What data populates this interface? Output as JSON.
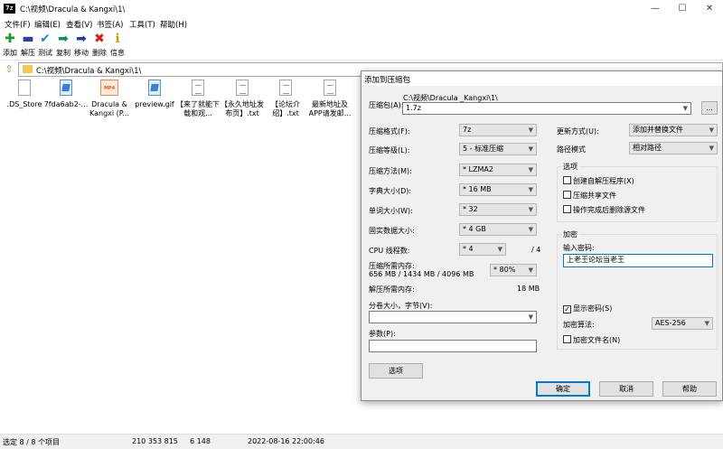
{
  "window": {
    "app_icon": "7z",
    "title": "C:\\视频\\Dracula & Kangxi\\1\\",
    "minimize_glyph": "—",
    "maximize_glyph": "☐",
    "close_glyph": "✕"
  },
  "menu": [
    "文件(F)",
    "编辑(E)",
    "查看(V)",
    "书签(A)",
    "工具(T)",
    "帮助(H)"
  ],
  "toolbar": [
    {
      "label": "添加",
      "icon": "add-icon",
      "glyph": "✚",
      "color": "#1a9b2c"
    },
    {
      "label": "解压",
      "icon": "extract-icon",
      "glyph": "▬",
      "color": "#2b3fa5"
    },
    {
      "label": "测试",
      "icon": "test-icon",
      "glyph": "✔",
      "color": "#1f8ea8"
    },
    {
      "label": "复制",
      "icon": "copy-icon",
      "glyph": "➡",
      "color": "#148a6a"
    },
    {
      "label": "移动",
      "icon": "move-icon",
      "glyph": "➡",
      "color": "#1d3ea0"
    },
    {
      "label": "删除",
      "icon": "delete-icon",
      "glyph": "✖",
      "color": "#d61b1b"
    },
    {
      "label": "信息",
      "icon": "info-icon",
      "glyph": "ℹ",
      "color": "#c8a000"
    }
  ],
  "address": {
    "path": "C:\\视频\\Dracula & Kangxi\\1\\"
  },
  "files": [
    {
      "name": ".DS_Store",
      "type": "file"
    },
    {
      "name": "7fda6ab2-...",
      "type": "img"
    },
    {
      "name": "Dracula & Kangxi (P...",
      "type": "mp4",
      "badge": "MP4"
    },
    {
      "name": "preview.gif",
      "type": "img"
    },
    {
      "name": "【来了就能下载和观...",
      "type": "txt"
    },
    {
      "name": "【永久地址发布页】.txt",
      "type": "txt"
    },
    {
      "name": "【论坛介绍】.txt",
      "type": "txt"
    },
    {
      "name": "最新地址及APP请发邮...",
      "type": "txt"
    }
  ],
  "status": {
    "selection": "选定 8 / 8 个项目",
    "size": "210 353 815",
    "packed": "6 148",
    "modified": "2022-08-16 22:00:46"
  },
  "dialog": {
    "title": "添加到压缩包",
    "archive_label": "压缩包(A):",
    "archive_dir": "C:\\视频\\Dracula _Kangxi\\1\\",
    "archive_name": "1.7z",
    "browse_label": "...",
    "format_label": "压缩格式(F):",
    "format_value": "7z",
    "level_label": "压缩等级(L):",
    "level_value": "5 - 标准压缩",
    "method_label": "压缩方法(M):",
    "method_value": "* LZMA2",
    "dict_label": "字典大小(D):",
    "dict_value": "* 16 MB",
    "word_label": "单词大小(W):",
    "word_value": "* 32",
    "solid_label": "固实数据大小:",
    "solid_value": "* 4 GB",
    "threads_label": "CPU 线程数:",
    "threads_value": "* 4",
    "threads_max": "/ 4",
    "mem_comp_label": "压缩所需内存:",
    "mem_comp_value": "656 MB / 1434 MB / 4096 MB",
    "mem_pct": "* 80%",
    "mem_decomp_label": "解压所需内存:",
    "mem_decomp_value": "18 MB",
    "split_label": "分卷大小，字节(V):",
    "split_value": "",
    "params_label": "参数(P):",
    "params_value": "",
    "options_btn": "选项",
    "update_label": "更新方式(U):",
    "update_value": "添加并替换文件",
    "path_label": "路径模式",
    "path_value": "相对路径",
    "options_group": "选项",
    "opt_sfx": "创建自解压程序(X)",
    "opt_shared": "压缩共享文件",
    "opt_delete": "操作完成后删除源文件",
    "enc_group": "加密",
    "pwd_label": "输入密码:",
    "pwd_value": "上老王论坛当老王",
    "show_pwd": "显示密码(S)",
    "enc_method_label": "加密算法:",
    "enc_method_value": "AES-256",
    "enc_names": "加密文件名(N)",
    "ok": "确定",
    "cancel": "取消",
    "help": "帮助"
  }
}
